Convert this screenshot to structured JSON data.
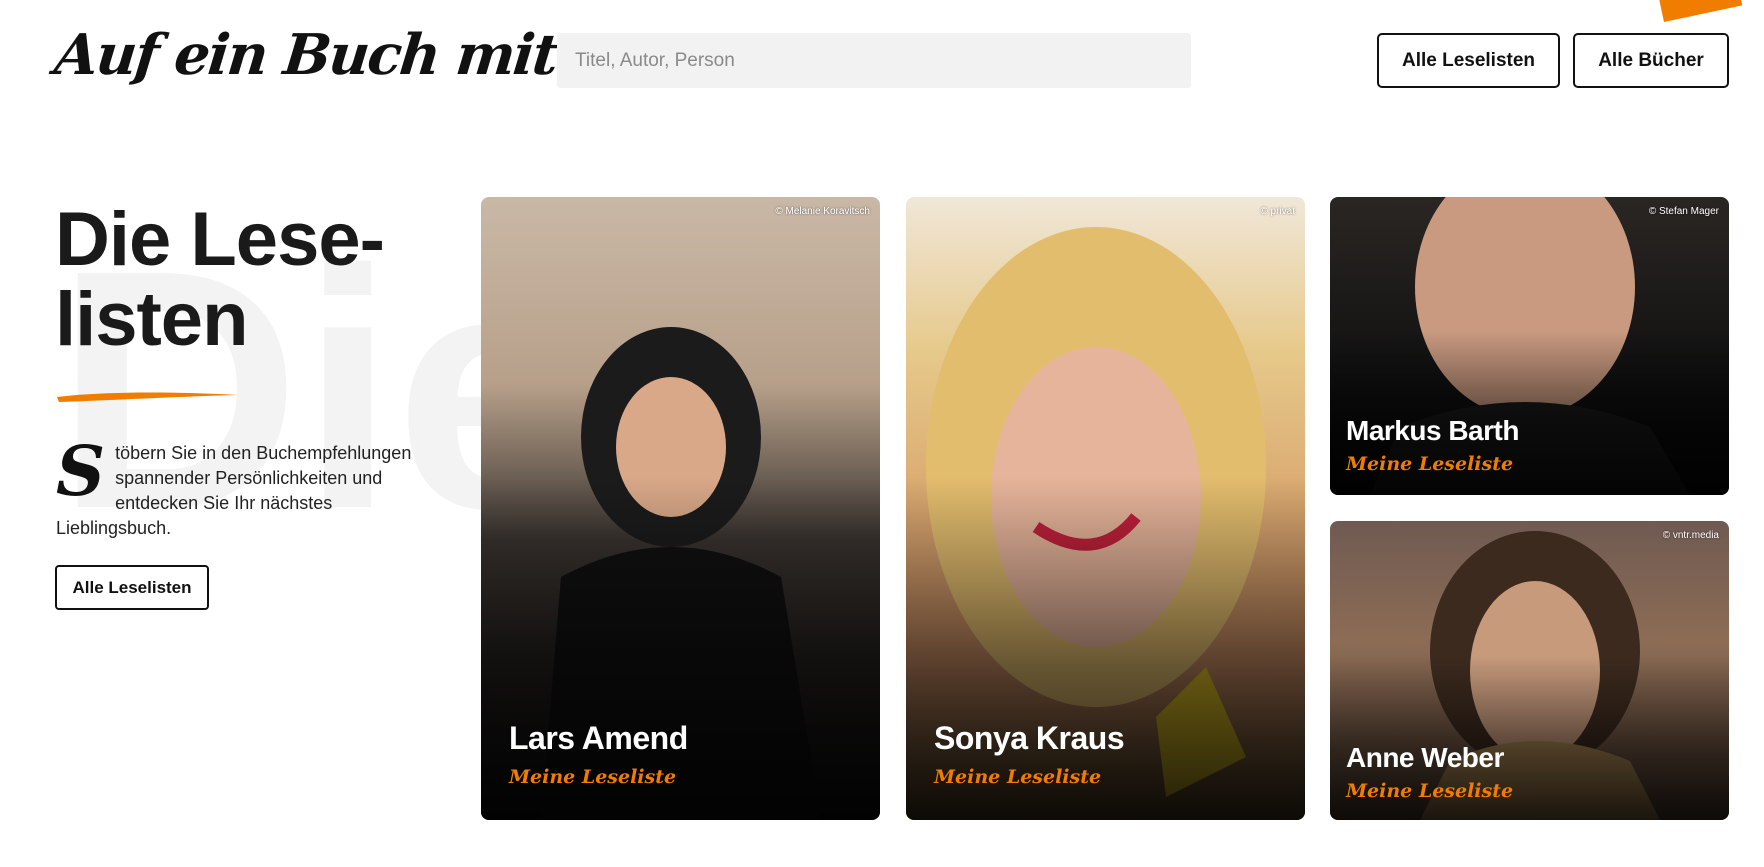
{
  "header": {
    "logo_text": "Auf ein Buch mit...",
    "search_placeholder": "Titel, Autor, Person",
    "btn_all_lists": "Alle Leselisten",
    "btn_all_books": "Alle Bücher"
  },
  "intro": {
    "title_line1": "Die Lese-",
    "title_line2": "listen",
    "watermark": "Die",
    "dropcap": "S",
    "text": "töbern Sie in den Buchempfehlungen spannender Persönlichkeiten und entdecken Sie Ihr nächstes Lieblingsbuch.",
    "button": "Alle Leselisten"
  },
  "cards": [
    {
      "name": "Lars Amend",
      "subtitle": "Meine Leseliste",
      "credit": "© Melanie Koravitsch"
    },
    {
      "name": "Sonya Kraus",
      "subtitle": "Meine Leseliste",
      "credit": "© privat"
    },
    {
      "name": "Markus Barth",
      "subtitle": "Meine Leseliste",
      "credit": "© Stefan Mager"
    },
    {
      "name": "Anne Weber",
      "subtitle": "Meine Leseliste",
      "credit": "© vntr.media"
    }
  ],
  "colors": {
    "accent": "#f07c00",
    "text": "#1a1a1a",
    "search_bg": "#f2f2f2"
  }
}
